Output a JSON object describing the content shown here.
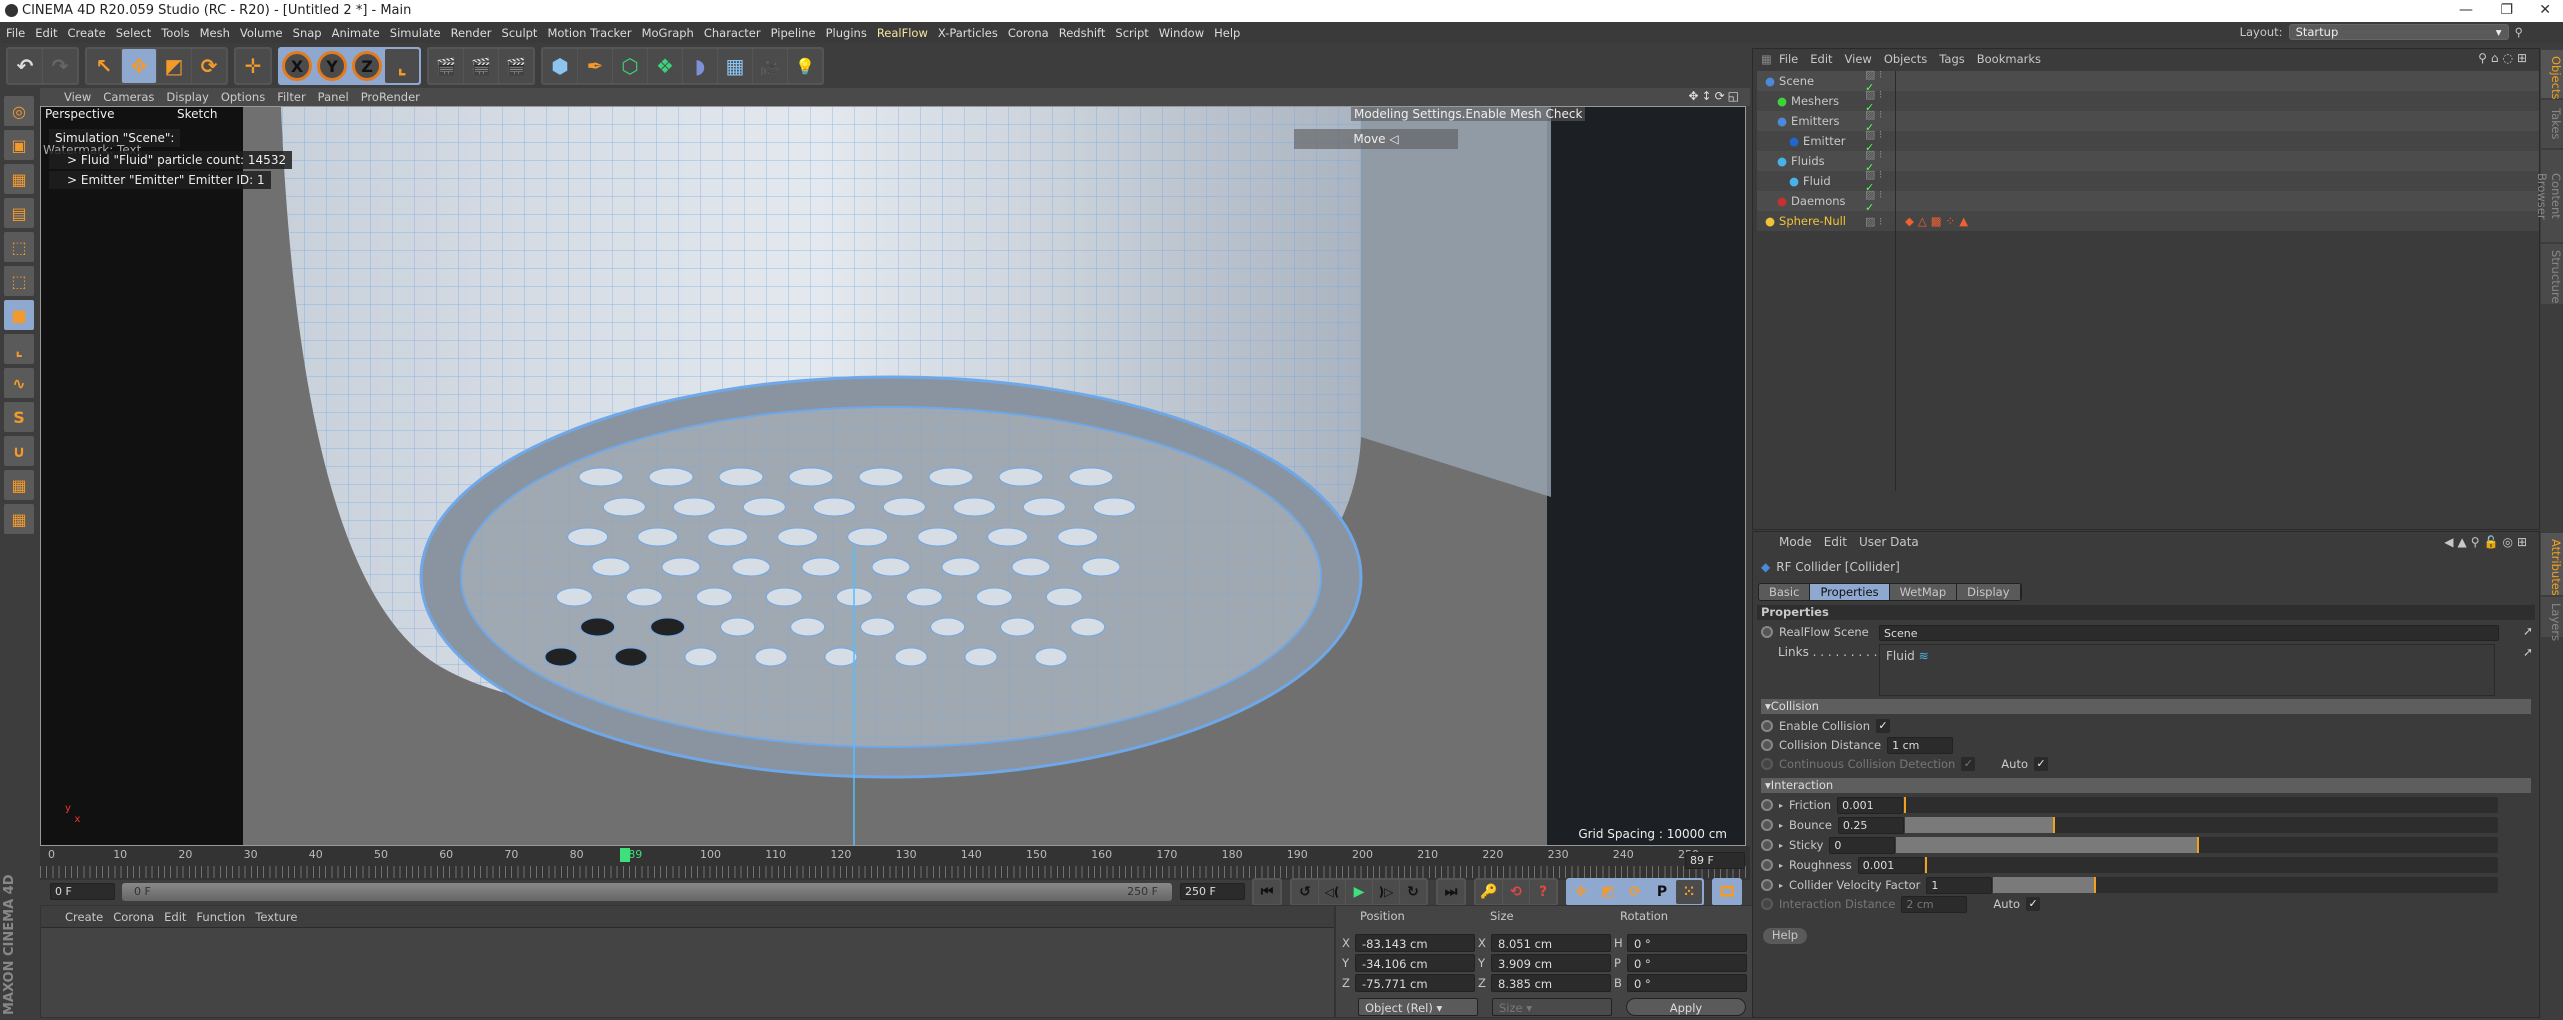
{
  "window": {
    "title": "CINEMA 4D R20.059 Studio (RC - R20) - [Untitled 2 *] - Main",
    "controls": [
      "—",
      "❐",
      "✕"
    ]
  },
  "menubar": {
    "items": [
      "File",
      "Edit",
      "Create",
      "Select",
      "Tools",
      "Mesh",
      "Volume",
      "Snap",
      "Animate",
      "Simulate",
      "Render",
      "Sculpt",
      "Motion Tracker",
      "MoGraph",
      "Character",
      "Pipeline",
      "Plugins",
      "RealFlow",
      "X-Particles",
      "Corona",
      "Redshift",
      "Script",
      "Window",
      "Help"
    ],
    "highlighted": "RealFlow",
    "layout_label": "Layout:",
    "layout_value": "Startup"
  },
  "toolbar": {
    "undo": "↶",
    "redo": "↷",
    "tools": [
      "↖",
      "✥",
      "◩",
      "⟳",
      "✛"
    ],
    "axes": [
      "X",
      "Y",
      "Z"
    ],
    "coord": "⌞",
    "render": [
      "🎬",
      "🎬",
      "🎬"
    ],
    "create": [
      "⬢",
      "✒",
      "⬡",
      "❖",
      "◗",
      "▦",
      "🎥",
      "💡"
    ]
  },
  "viewport": {
    "menu": [
      "View",
      "Cameras",
      "Display",
      "Options",
      "Filter",
      "Panel",
      "ProRender"
    ],
    "camera": "Perspective",
    "mode": "Sketch",
    "hud_title": "Simulation \"Scene\":",
    "watermark": "Watermark: Text",
    "hud_lines": [
      "> Fluid \"Fluid\" particle count: 14532",
      "> Emitter \"Emitter\" Emitter ID: 1"
    ],
    "mesh_check": "Modeling Settings.Enable Mesh Check",
    "move_label": "Move ◁",
    "grid_spacing": "Grid Spacing : 10000 cm",
    "nav_icons": "✥↕⟳◱",
    "accent": "#6fa8e8"
  },
  "timeline": {
    "ticks": [
      "0",
      "10",
      "20",
      "30",
      "40",
      "50",
      "60",
      "70",
      "80",
      "89",
      "100",
      "110",
      "120",
      "130",
      "140",
      "150",
      "160",
      "170",
      "180",
      "190",
      "200",
      "210",
      "220",
      "230",
      "240",
      "250"
    ],
    "current": 89,
    "max": 250,
    "current_field": "89 F",
    "start_field": "0 F",
    "range_start": "0 F",
    "range_end": "250 F",
    "end_field": "250 F",
    "transport": [
      "⏮",
      "↺",
      "◁(",
      "▶",
      ")▷",
      "↻",
      "⏭"
    ],
    "key_buttons": [
      "🔑",
      "⟲",
      "?"
    ],
    "key_modes": [
      "✥",
      "◩",
      "⟳",
      "P",
      "⁙",
      "🎞"
    ]
  },
  "material_manager": {
    "menu": [
      "Create",
      "Corona",
      "Edit",
      "Function",
      "Texture"
    ],
    "brand": "MAXON CINEMA 4D"
  },
  "coordinates": {
    "headers": [
      "Position",
      "Size",
      "Rotation"
    ],
    "rows": [
      {
        "pl": "X",
        "p": "-83.143 cm",
        "sl": "X",
        "s": "8.051 cm",
        "rl": "H",
        "r": "0 °"
      },
      {
        "pl": "Y",
        "p": "-34.106 cm",
        "sl": "Y",
        "s": "3.909 cm",
        "rl": "P",
        "r": "0 °"
      },
      {
        "pl": "Z",
        "p": "-75.771 cm",
        "sl": "Z",
        "s": "8.385 cm",
        "rl": "B",
        "r": "0 °"
      }
    ],
    "mode": "Object (Rel)",
    "size_mode": "Size",
    "apply": "Apply"
  },
  "object_manager": {
    "menu": [
      "File",
      "Edit",
      "View",
      "Objects",
      "Tags",
      "Bookmarks"
    ],
    "objects": [
      {
        "name": "Scene",
        "icon": "scene-icon",
        "color": "#4a8ad8"
      },
      {
        "name": "Meshers",
        "icon": "mesher-icon",
        "color": "#3cd23c"
      },
      {
        "name": "Emitters",
        "icon": "emitters-icon",
        "color": "#4a8ad8"
      },
      {
        "name": "Emitter",
        "icon": "emitter-icon",
        "color": "#2266cc"
      },
      {
        "name": "Fluids",
        "icon": "fluids-icon",
        "color": "#4ab0e8"
      },
      {
        "name": "Fluid",
        "icon": "fluid-icon",
        "color": "#4ab0e8"
      },
      {
        "name": "Daemons",
        "icon": "daemons-icon",
        "color": "#c83030"
      },
      {
        "name": "Sphere-Null",
        "icon": "null-icon",
        "color": "#f2c23a"
      }
    ],
    "check": "✓"
  },
  "attributes": {
    "menu": [
      "Mode",
      "Edit",
      "User Data"
    ],
    "object_title": "RF Collider [Collider]",
    "tabs": [
      "Basic",
      "Properties",
      "WetMap",
      "Display"
    ],
    "active_tab": "Properties",
    "properties_header": "Properties",
    "realflow_scene_label": "RealFlow Scene",
    "realflow_scene_value": "Scene",
    "links_label": "Links . . . . . . . . .",
    "links_item": "Fluid",
    "collision_header": "▾Collision",
    "enable_collision": "Enable Collision",
    "collision_distance_label": "Collision Distance",
    "collision_distance": "1 cm",
    "ccd_label": "Continuous Collision Detection",
    "auto_label": "Auto",
    "interaction_header": "▾Interaction",
    "sliders": [
      {
        "label": "Friction",
        "value": "0.001",
        "fill": 0.0
      },
      {
        "label": "Bounce",
        "value": "0.25",
        "fill": 0.25
      },
      {
        "label": "Sticky",
        "value": "0",
        "fill": 0.5
      },
      {
        "label": "Roughness",
        "value": "0.001",
        "fill": 0.0
      },
      {
        "label": "Collider Velocity Factor",
        "value": "1",
        "fill": 0.2
      }
    ],
    "interaction_distance_label": "Interaction Distance",
    "interaction_distance": "2 cm",
    "auto2_label": "Auto",
    "help": "Help",
    "check": "✓"
  },
  "side_tabs": {
    "top": [
      "Objects",
      "Takes",
      "Content Browser",
      "Structure"
    ],
    "bottom": [
      "Attributes",
      "Layers"
    ]
  }
}
